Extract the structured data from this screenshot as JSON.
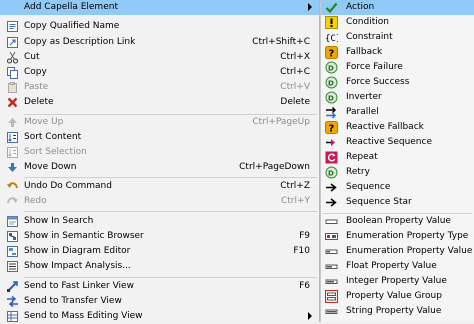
{
  "main_menu": {
    "items": [
      {
        "label": "Add Capella Element",
        "shortcut": "",
        "icon": "submenu-arrow",
        "submenu": true,
        "highlighted": true
      },
      {
        "label": "Copy Qualified Name",
        "shortcut": "",
        "icon": "copy-name-icon"
      },
      {
        "label": "Copy as Description Link",
        "shortcut": "Ctrl+Shift+C",
        "icon": "link-icon"
      },
      {
        "label": "Cut",
        "shortcut": "Ctrl+X",
        "icon": "scissors-icon"
      },
      {
        "label": "Copy",
        "shortcut": "Ctrl+C",
        "icon": "copy-icon"
      },
      {
        "label": "Paste",
        "shortcut": "Ctrl+V",
        "icon": "paste-icon",
        "disabled": true
      },
      {
        "label": "Delete",
        "shortcut": "Delete",
        "icon": "delete-icon"
      },
      {
        "label": "Move Up",
        "shortcut": "Ctrl+PageUp",
        "icon": "move-up-icon",
        "disabled": true
      },
      {
        "label": "Sort Content",
        "shortcut": "",
        "icon": "sort-content-icon"
      },
      {
        "label": "Sort Selection",
        "shortcut": "",
        "icon": "sort-selection-icon",
        "disabled": true
      },
      {
        "label": "Move Down",
        "shortcut": "Ctrl+PageDown",
        "icon": "move-down-icon"
      },
      {
        "label": "Undo Do Command",
        "shortcut": "Ctrl+Z",
        "icon": "undo-icon"
      },
      {
        "label": "Redo",
        "shortcut": "Ctrl+Y",
        "icon": "redo-icon",
        "disabled": true
      },
      {
        "label": "Show In Search",
        "shortcut": "",
        "icon": "search-view-icon"
      },
      {
        "label": "Show in Semantic Browser",
        "shortcut": "F9",
        "icon": "semantic-browser-icon"
      },
      {
        "label": "Show in Diagram Editor",
        "shortcut": "F10",
        "icon": "diagram-editor-icon"
      },
      {
        "label": "Show Impact Analysis...",
        "shortcut": "",
        "icon": "impact-analysis-icon"
      },
      {
        "label": "Send to Fast Linker View",
        "shortcut": "F6",
        "icon": "fast-linker-icon"
      },
      {
        "label": "Send to Transfer View",
        "shortcut": "",
        "icon": "transfer-view-icon"
      },
      {
        "label": "Send to Mass Editing View",
        "shortcut": "",
        "icon": "mass-editing-icon",
        "submenu": true
      }
    ]
  },
  "sub_menu": {
    "items": [
      {
        "label": "Action",
        "icon": "action-check-icon",
        "highlighted": true
      },
      {
        "label": "Condition",
        "icon": "condition-exclamation-icon"
      },
      {
        "label": "Constraint",
        "icon": "constraint-icon"
      },
      {
        "label": "Fallback",
        "icon": "fallback-question-icon"
      },
      {
        "label": "Force Failure",
        "icon": "force-failure-icon"
      },
      {
        "label": "Force Success",
        "icon": "force-success-icon"
      },
      {
        "label": "Inverter",
        "icon": "inverter-icon"
      },
      {
        "label": "Parallel",
        "icon": "parallel-arrows-icon"
      },
      {
        "label": "Reactive Fallback",
        "icon": "reactive-fallback-icon"
      },
      {
        "label": "Reactive Sequence",
        "icon": "reactive-sequence-icon"
      },
      {
        "label": "Repeat",
        "icon": "repeat-icon"
      },
      {
        "label": "Retry",
        "icon": "retry-icon"
      },
      {
        "label": "Sequence",
        "icon": "sequence-arrow-icon"
      },
      {
        "label": "Sequence Star",
        "icon": "sequence-star-icon"
      },
      {
        "label": "Boolean Property Value",
        "icon": "boolean-property-icon"
      },
      {
        "label": "Enumeration Property Type",
        "icon": "enumeration-type-icon"
      },
      {
        "label": "Enumeration Property Value",
        "icon": "enumeration-value-icon"
      },
      {
        "label": "Float Property Value",
        "icon": "float-property-icon"
      },
      {
        "label": "Integer Property Value",
        "icon": "integer-property-icon"
      },
      {
        "label": "Property Value Group",
        "icon": "property-group-icon"
      },
      {
        "label": "String Property Value",
        "icon": "string-property-icon"
      }
    ]
  },
  "colors": {
    "highlight": "#91c9f7",
    "disabled_text": "#8c8c8c",
    "menu_background": "#f2f2f2"
  }
}
